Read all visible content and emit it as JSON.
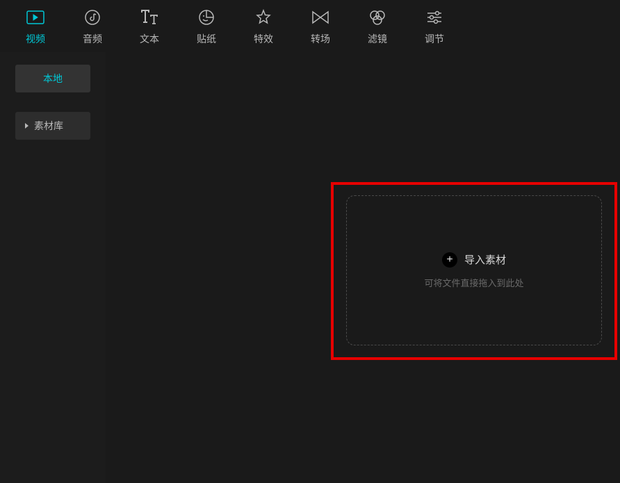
{
  "topTabs": [
    {
      "key": "video",
      "label": "视频",
      "active": true
    },
    {
      "key": "audio",
      "label": "音频",
      "active": false
    },
    {
      "key": "text",
      "label": "文本",
      "active": false
    },
    {
      "key": "sticker",
      "label": "贴纸",
      "active": false
    },
    {
      "key": "effect",
      "label": "特效",
      "active": false
    },
    {
      "key": "transition",
      "label": "转场",
      "active": false
    },
    {
      "key": "filter",
      "label": "滤镜",
      "active": false
    },
    {
      "key": "adjust",
      "label": "调节",
      "active": false
    }
  ],
  "sidebar": {
    "local": "本地",
    "library": "素材库"
  },
  "dropZone": {
    "importLabel": "导入素材",
    "hint": "可将文件直接拖入到此处",
    "plusSymbol": "+"
  }
}
